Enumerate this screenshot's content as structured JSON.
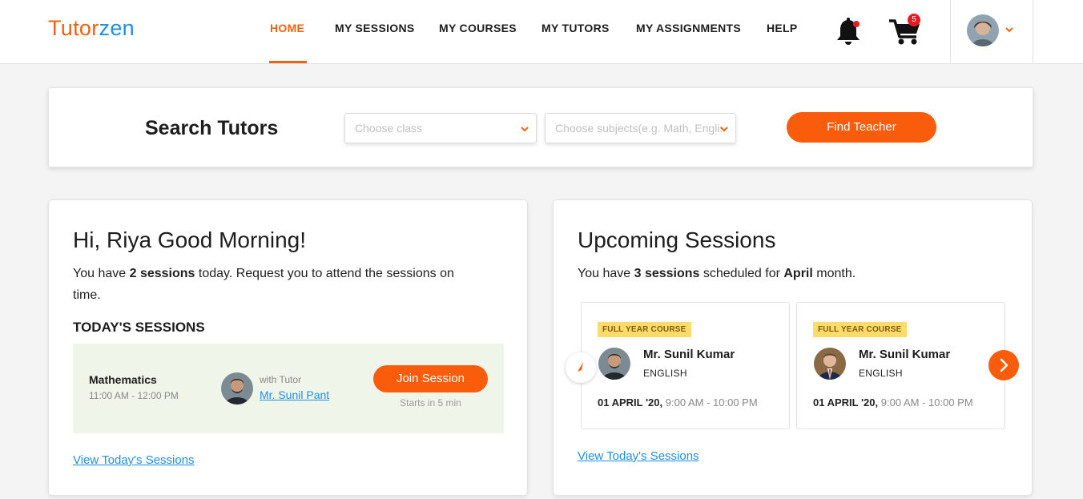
{
  "brand": {
    "part1": "Tutor",
    "part2": "zen"
  },
  "nav": {
    "items": [
      {
        "label": "HOME"
      },
      {
        "label": "MY SESSIONS"
      },
      {
        "label": "MY COURSES"
      },
      {
        "label": "MY TUTORS"
      },
      {
        "label": "MY ASSIGNMENTS"
      },
      {
        "label": "HELP"
      }
    ],
    "active_item": "HOME",
    "cart_count": "5"
  },
  "search": {
    "title": "Search Tutors",
    "class_placeholder": "Choose class",
    "subject_placeholder": "Choose subjects(e.g. Math, English)",
    "button_label": "Find Teacher"
  },
  "greeting": {
    "title": "Hi, Riya Good Morning!",
    "text_pre": "You have ",
    "text_bold": "2 sessions",
    "text_post": " today. Request you to attend the sessions on time.",
    "today_heading": "TODAY'S SESSIONS",
    "session": {
      "subject": "Mathematics",
      "time": "11:00 AM - 12:00 PM",
      "with_label": "with Tutor",
      "tutor": "Mr. Sunil Pant",
      "join_label": "Join Session",
      "starts_note": "Starts in 5 min"
    },
    "view_link": "View Today's Sessions"
  },
  "upcoming": {
    "title": "Upcoming Sessions",
    "text_pre": "You have ",
    "text_bold1": "3 sessions",
    "text_mid": " scheduled for ",
    "text_bold2": "April",
    "text_post": " month.",
    "sessions": [
      {
        "badge": "FULL YEAR COURSE",
        "tutor": "Mr. Sunil Kumar",
        "subject": "ENGLISH",
        "date": "01 APRIL '20,",
        "time": "9:00 AM - 10:00 PM"
      },
      {
        "badge": "FULL YEAR COURSE",
        "tutor": "Mr. Sunil Kumar",
        "subject": "ENGLISH",
        "date": "01 APRIL '20,",
        "time": "9:00 AM - 10:00 PM"
      }
    ],
    "view_link": "View Today's Sessions"
  },
  "colors": {
    "accent": "#f95c0b",
    "brand_blue": "#1f8fe8",
    "badge": "#ffdb6a",
    "session_bg": "#eff6e9"
  }
}
